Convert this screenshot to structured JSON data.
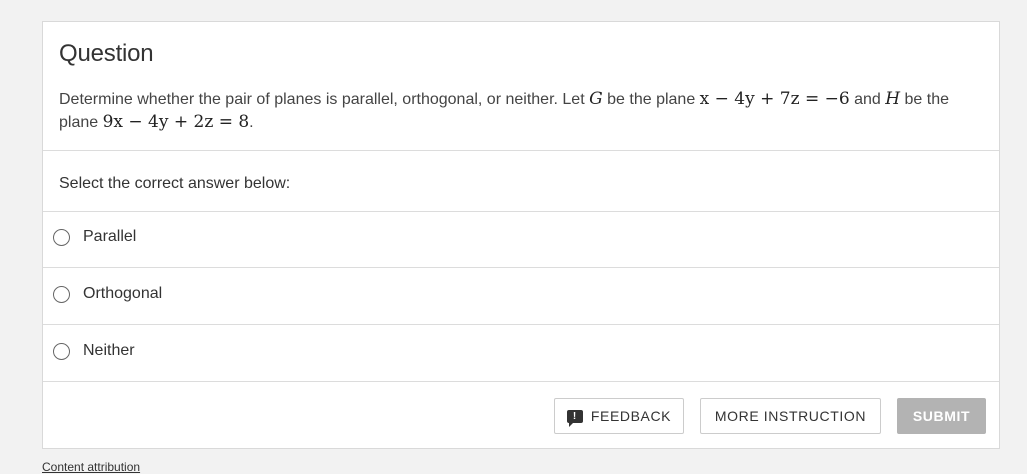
{
  "question": {
    "title": "Question",
    "text_1": "Determine whether the pair of planes is parallel, orthogonal, or neither. Let ",
    "G": "G",
    "text_2": " be the plane ",
    "eq_G": "x − 4y + 7z = −6",
    "text_3": " and ",
    "H": "H",
    "text_4": " be the plane ",
    "eq_H": "9x − 4y + 2z = 8",
    "text_5": "."
  },
  "prompt": "Select the correct answer below:",
  "options": [
    {
      "label": "Parallel",
      "selected": false
    },
    {
      "label": "Orthogonal",
      "selected": false
    },
    {
      "label": "Neither",
      "selected": false
    }
  ],
  "buttons": {
    "feedback_icon": "feedback-icon",
    "feedback": "FEEDBACK",
    "more_instruction": "MORE INSTRUCTION",
    "submit": "SUBMIT"
  },
  "footer": {
    "attribution": "Content attribution"
  },
  "colors": {
    "submit_disabled": "#b3b3b3",
    "background": "#f2f2f2"
  }
}
